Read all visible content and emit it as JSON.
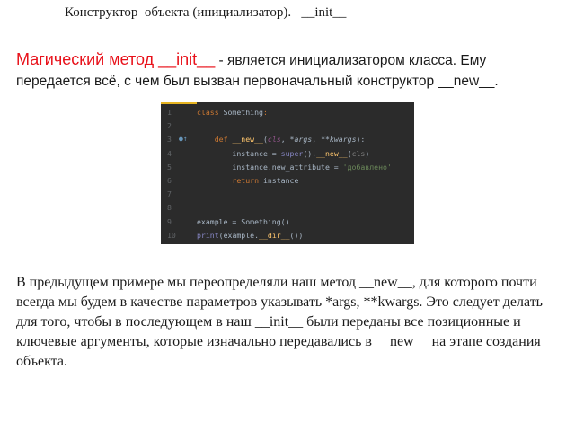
{
  "title": "Конструктор  объекта (инициализатор).   __init__",
  "intro": {
    "highlight": "Магический метод __init__",
    "rest": " - является инициализатором класса. Ему",
    "line2": "передается всё, с чем был вызван первоначальный конструктор __new__."
  },
  "code": {
    "lines": [
      {
        "n": "1",
        "parts": [
          [
            "kw",
            "class "
          ],
          [
            "cls",
            "Something"
          ],
          [
            "kw",
            ":"
          ]
        ]
      },
      {
        "n": "2",
        "parts": []
      },
      {
        "n": "3",
        "parts": [
          [
            "kw",
            "    def "
          ],
          [
            "fn",
            "__new__"
          ],
          [
            "cls",
            "("
          ],
          [
            "self",
            "cls"
          ],
          [
            "cls",
            ", "
          ],
          [
            "it",
            "*args"
          ],
          [
            "cls",
            ", "
          ],
          [
            "it",
            "**kwargs"
          ],
          [
            "cls",
            "):"
          ]
        ]
      },
      {
        "n": "4",
        "parts": [
          [
            "cls",
            "        instance = "
          ],
          [
            "sup",
            "super"
          ],
          [
            "cls",
            "()."
          ],
          [
            "fn",
            "__new__"
          ],
          [
            "cls",
            "("
          ],
          [
            "dim",
            "cls"
          ],
          [
            "cls",
            ")"
          ]
        ]
      },
      {
        "n": "5",
        "parts": [
          [
            "cls",
            "        instance.new_attribute = "
          ],
          [
            "str",
            "'добавлено'"
          ]
        ]
      },
      {
        "n": "6",
        "parts": [
          [
            "kw",
            "        return "
          ],
          [
            "cls",
            "instance"
          ]
        ]
      },
      {
        "n": "7",
        "parts": []
      },
      {
        "n": "8",
        "parts": []
      },
      {
        "n": "9",
        "parts": [
          [
            "cls",
            "example = Something()"
          ]
        ]
      },
      {
        "n": "10",
        "parts": [
          [
            "sup",
            "print"
          ],
          [
            "cls",
            "(example."
          ],
          [
            "gold",
            "__dir__"
          ],
          [
            "cls",
            "())"
          ]
        ]
      }
    ]
  },
  "body": "В предыдущем примере мы переопределяли наш метод __new__, для которого почти всегда мы будем в качестве параметров указывать *args, **kwargs. Это следует делать для того, чтобы в последующем в наш __init__ были переданы все позиционные и ключевые аргументы, которые изначально передавались в __new__ на этапе создания объекта."
}
